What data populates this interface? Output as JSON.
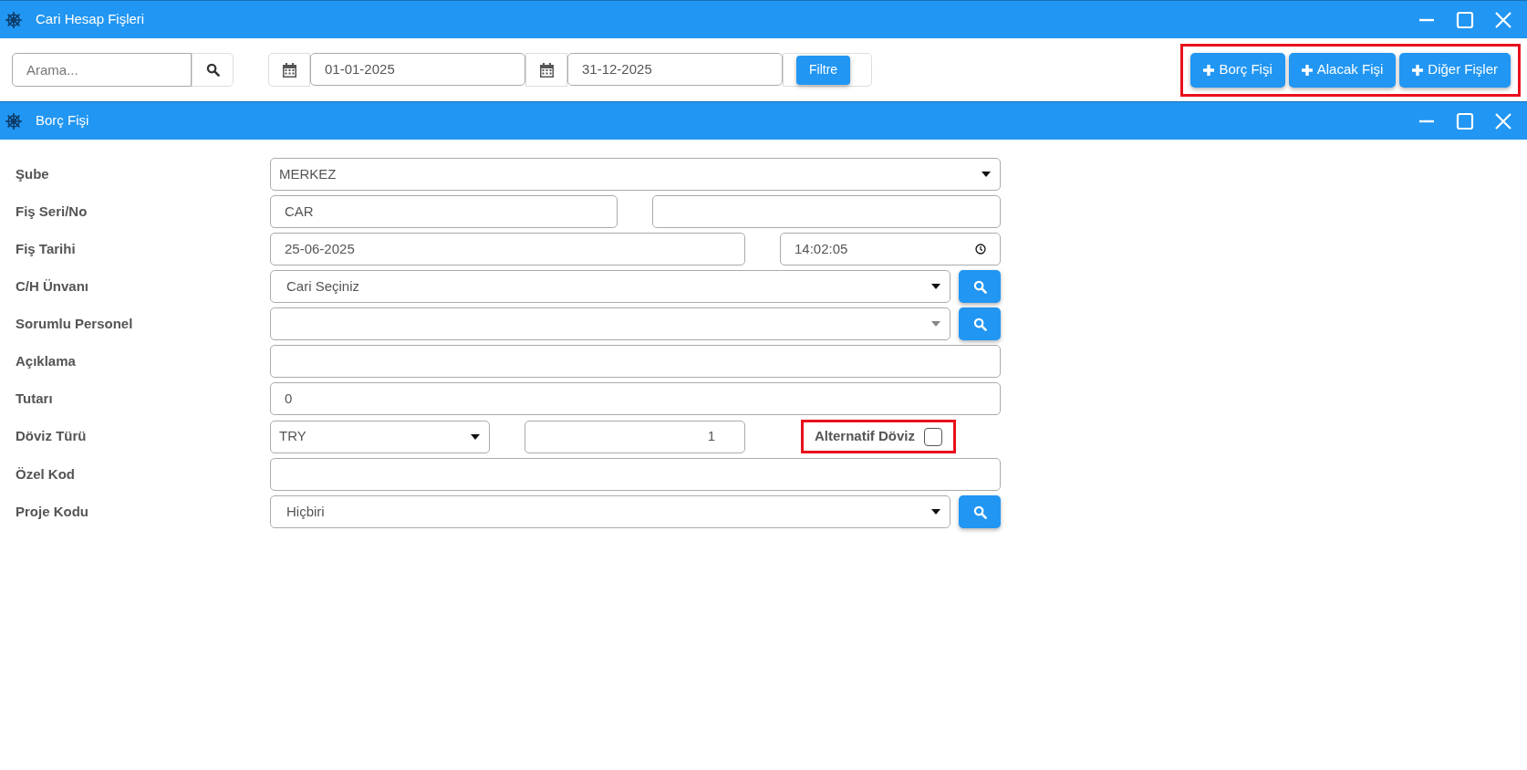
{
  "window": {
    "title": "Cari Hesap Fişleri"
  },
  "toolbar": {
    "search": {
      "placeholder": "Arama..."
    },
    "date_from": "01-01-2025",
    "date_to": "31-12-2025",
    "filter_button": "Filtre",
    "actions_highlighted": true,
    "actions": [
      {
        "label": "Borç Fişi"
      },
      {
        "label": "Alacak Fişi"
      },
      {
        "label": "Diğer Fişler"
      }
    ]
  },
  "dialog": {
    "title": "Borç Fişi",
    "fields": [
      {
        "label": "Şube",
        "kind": "select",
        "value": "MERKEZ"
      },
      {
        "label": "Fiş Seri/No",
        "kind": "pair",
        "value": "CAR"
      },
      {
        "label": "Fiş Tarihi",
        "kind": "datetime",
        "value": "25-06-2025",
        "time": "14:02:05"
      },
      {
        "label": "C/H Ünvanı",
        "kind": "lookup",
        "value": "Cari Seçiniz"
      },
      {
        "label": "Sorumlu Personel",
        "kind": "lookup"
      },
      {
        "label": "Açıklama",
        "kind": "text"
      },
      {
        "label": "Tutarı",
        "kind": "text",
        "value": "0"
      },
      {
        "label": "Döviz Türü",
        "kind": "currency",
        "value": "TRY",
        "rate": "1",
        "checkbox_label": "Alternatif Döviz",
        "checked": false,
        "highlighted": true
      },
      {
        "label": "Özel Kod",
        "kind": "text"
      },
      {
        "label": "Proje Kodu",
        "kind": "lookup",
        "value": "Hiçbiri"
      }
    ]
  }
}
